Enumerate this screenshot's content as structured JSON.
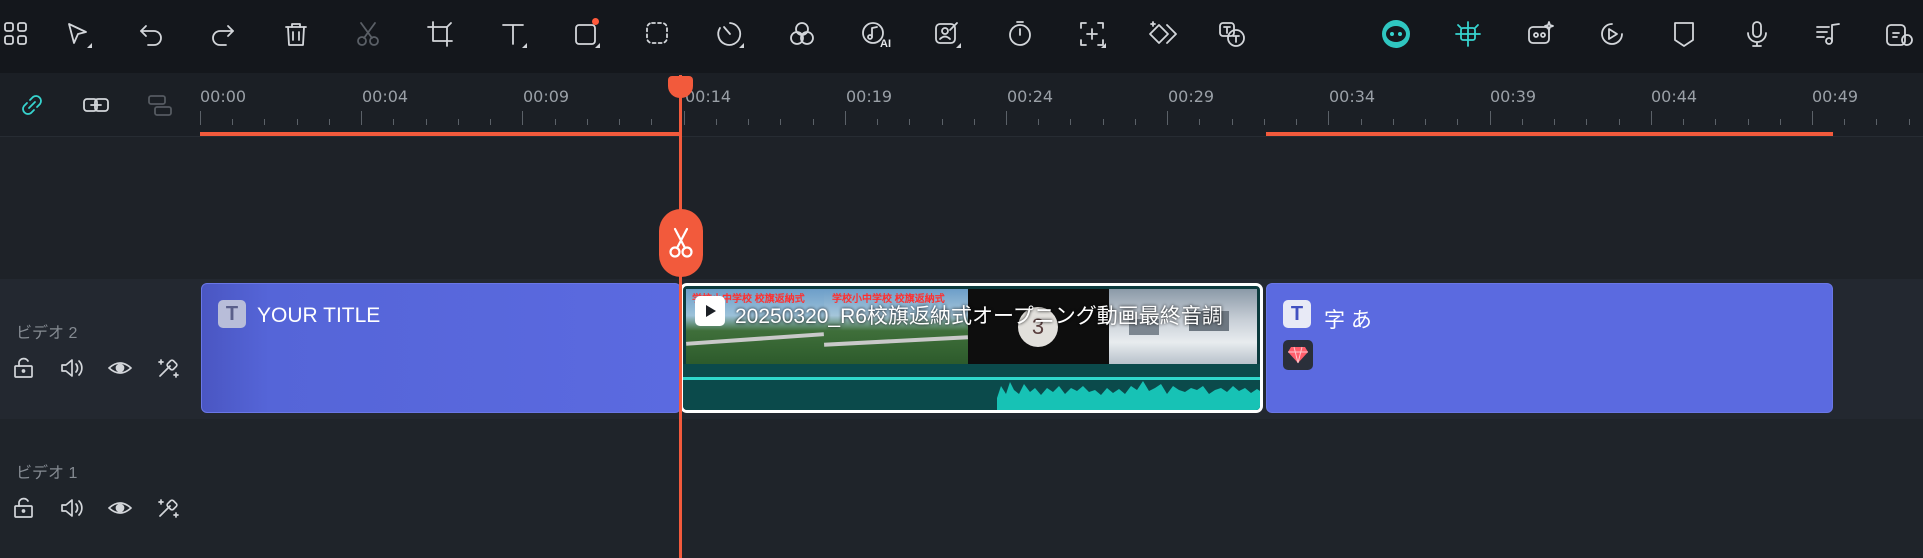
{
  "toolbar": {
    "tools": [
      {
        "name": "layout-icon"
      },
      {
        "name": "select-arrow-icon"
      },
      {
        "name": "undo-icon"
      },
      {
        "name": "redo-icon"
      },
      {
        "name": "delete-icon"
      },
      {
        "name": "cut-icon",
        "disabled": true
      },
      {
        "name": "crop-icon"
      },
      {
        "name": "text-icon"
      },
      {
        "name": "shape-icon"
      },
      {
        "name": "ai-select-icon"
      },
      {
        "name": "speed-icon"
      },
      {
        "name": "color-icon"
      },
      {
        "name": "ai-audio-icon",
        "ai": "AI"
      },
      {
        "name": "edit-image-icon"
      },
      {
        "name": "timer-icon"
      },
      {
        "name": "add-marker-icon"
      },
      {
        "name": "keyframe-icon"
      },
      {
        "name": "speech-to-text-icon"
      }
    ],
    "right_tools": [
      {
        "name": "ai-assistant-icon"
      },
      {
        "name": "auto-detect-icon"
      },
      {
        "name": "ai-copilot-icon"
      },
      {
        "name": "play-preview-icon"
      },
      {
        "name": "marker-icon"
      },
      {
        "name": "microphone-icon"
      },
      {
        "name": "music-icon"
      },
      {
        "name": "snapshot-icon"
      }
    ],
    "accent_color": "#37d4cf"
  },
  "ruler": {
    "ticks": [
      "00:00",
      "00:04",
      "00:09",
      "00:14",
      "00:19",
      "00:24",
      "00:29",
      "00:34",
      "00:39",
      "00:44",
      "00:49"
    ],
    "playhead_time": "00:14",
    "playhead_color": "#f25a3c"
  },
  "tracks": [
    {
      "name": "ビデオ 2"
    },
    {
      "name": "ビデオ 1"
    }
  ],
  "clips": {
    "title1": {
      "label": "YOUR TITLE",
      "badge": "T"
    },
    "video": {
      "label": "20250320_R6校旗返納式オープニング動画最終音調",
      "thumb_text": "学校小中学校 校旗返納式",
      "countdown": "3"
    },
    "title2": {
      "label": "字 あ",
      "badge": "T"
    }
  },
  "colors": {
    "title_clip": "#5b6ae0",
    "audio_wave": "#17c2b5"
  }
}
